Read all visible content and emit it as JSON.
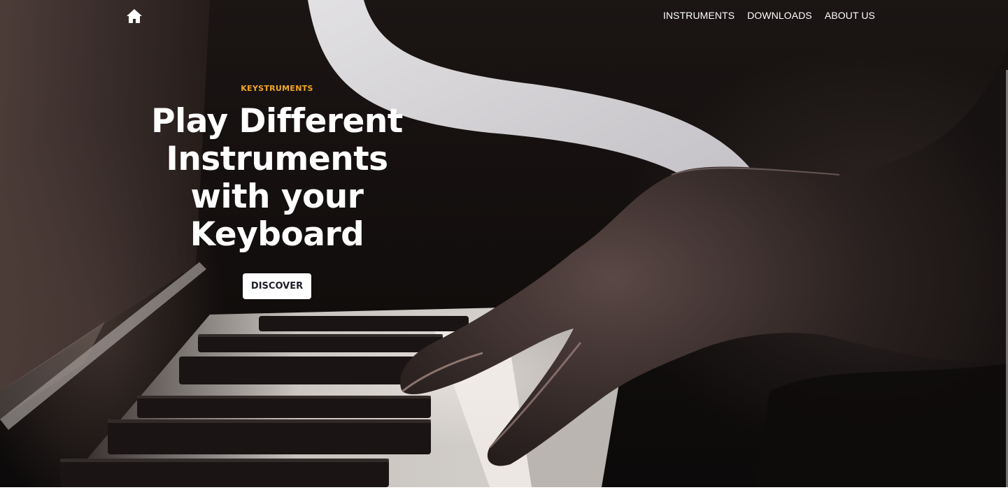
{
  "nav": {
    "home_icon": "home-icon",
    "items": [
      {
        "label": "INSTRUMENTS"
      },
      {
        "label": "DOWNLOADS"
      },
      {
        "label": "ABOUT US"
      }
    ]
  },
  "hero": {
    "eyebrow": "KEYSTRUMENTS",
    "title": "Play Different Instruments with your Keyboard",
    "cta_label": "DISCOVER",
    "background": "photo of a hand playing piano keys"
  },
  "colors": {
    "accent": "#f2a623",
    "text": "#ffffff",
    "button_text": "#1e1e2a",
    "background": "#120e0d"
  }
}
